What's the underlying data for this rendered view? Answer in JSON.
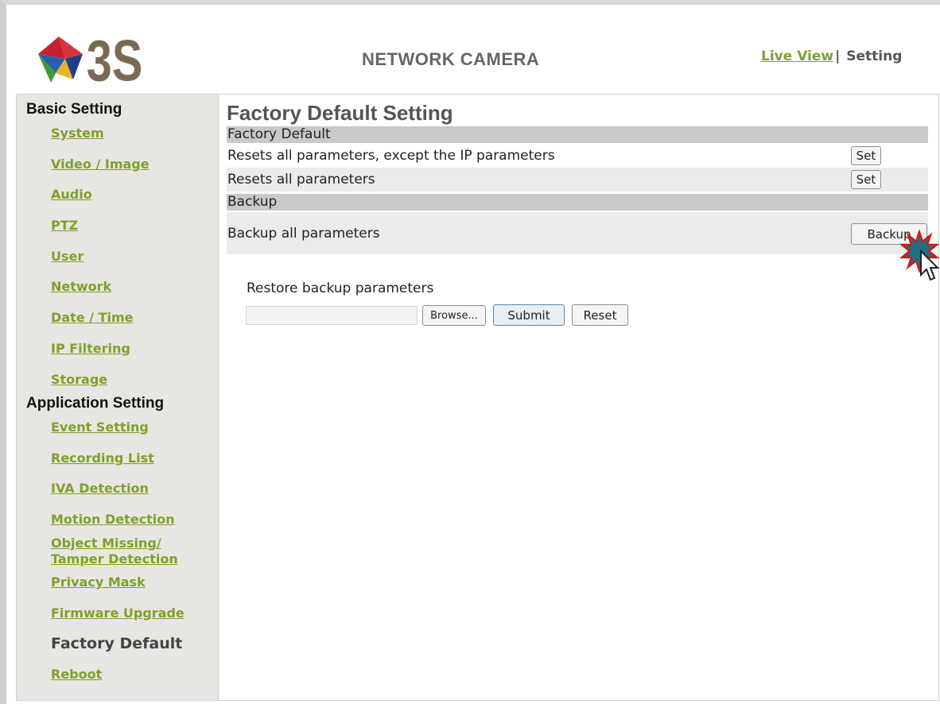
{
  "header": {
    "logo_text": "3S",
    "product_title": "NETWORK CAMERA",
    "live_view_link": "Live View",
    "separator": "|",
    "setting_label": "Setting"
  },
  "sidebar": {
    "basic_heading": "Basic Setting",
    "basic_items": [
      "System",
      "Video / Image",
      "Audio",
      "PTZ",
      "User",
      "Network",
      "Date / Time",
      "IP Filtering",
      "Storage"
    ],
    "application_heading": "Application Setting",
    "application_items": [
      "Event Setting",
      "Recording List",
      "IVA Detection",
      "Motion Detection",
      "Object Missing/",
      "Tamper Detection",
      "Privacy Mask",
      "Firmware Upgrade"
    ],
    "current_item": "Factory Default",
    "reboot": "Reboot"
  },
  "main": {
    "title": "Factory Default Setting",
    "factory_section": "Factory Default",
    "reset_except_ip_label": "Resets all parameters, except the IP parameters",
    "reset_except_ip_button": "Set",
    "reset_all_label": "Resets all parameters",
    "reset_all_button": "Set",
    "backup_section": "Backup",
    "backup_label": "Backup all parameters",
    "backup_button": "Backup",
    "restore_label": "Restore backup parameters",
    "browse_button": "Browse...",
    "submit_button": "Submit",
    "reset_button": "Reset",
    "file_value": ""
  },
  "colors": {
    "link_green": "#7ea12a",
    "section_grey": "#c9c9c9",
    "sidebar_bg": "#e8e6e2"
  }
}
